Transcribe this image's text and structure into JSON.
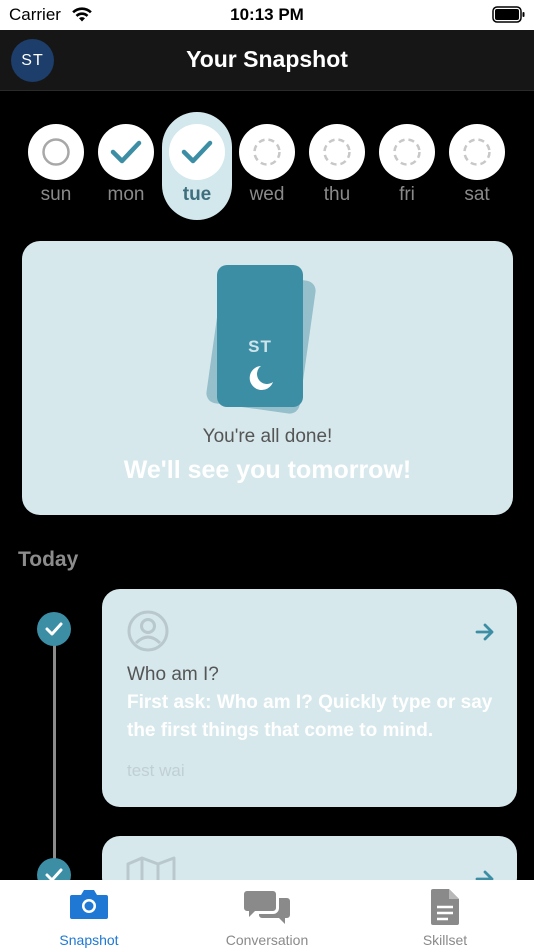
{
  "status": {
    "carrier": "Carrier",
    "time": "10:13 PM"
  },
  "header": {
    "avatar": "ST",
    "title": "Your Snapshot"
  },
  "week": {
    "days": [
      {
        "label": "sun",
        "state": "empty"
      },
      {
        "label": "mon",
        "state": "done"
      },
      {
        "label": "tue",
        "state": "done-today"
      },
      {
        "label": "wed",
        "state": "upcoming"
      },
      {
        "label": "thu",
        "state": "upcoming"
      },
      {
        "label": "fri",
        "state": "upcoming"
      },
      {
        "label": "sat",
        "state": "upcoming"
      }
    ]
  },
  "done_card": {
    "initials": "ST",
    "message": "You're all done!",
    "sub": "We'll see you tomorrow!"
  },
  "today": {
    "title": "Today",
    "tasks": [
      {
        "icon": "person-icon",
        "title": "Who am I?",
        "body": "First ask: Who am I? Quickly type or say the first things that come to mind.",
        "answer": "test wai"
      },
      {
        "icon": "map-icon"
      }
    ]
  },
  "tabs": [
    {
      "label": "Snapshot",
      "icon": "camera-icon",
      "active": true
    },
    {
      "label": "Conversation",
      "icon": "chat-bubbles-icon",
      "active": false
    },
    {
      "label": "Skillset",
      "icon": "document-icon",
      "active": false
    }
  ],
  "colors": {
    "accent": "#3c8ea5",
    "card": "#d6e8ec",
    "tab_active": "#1e78d4"
  }
}
